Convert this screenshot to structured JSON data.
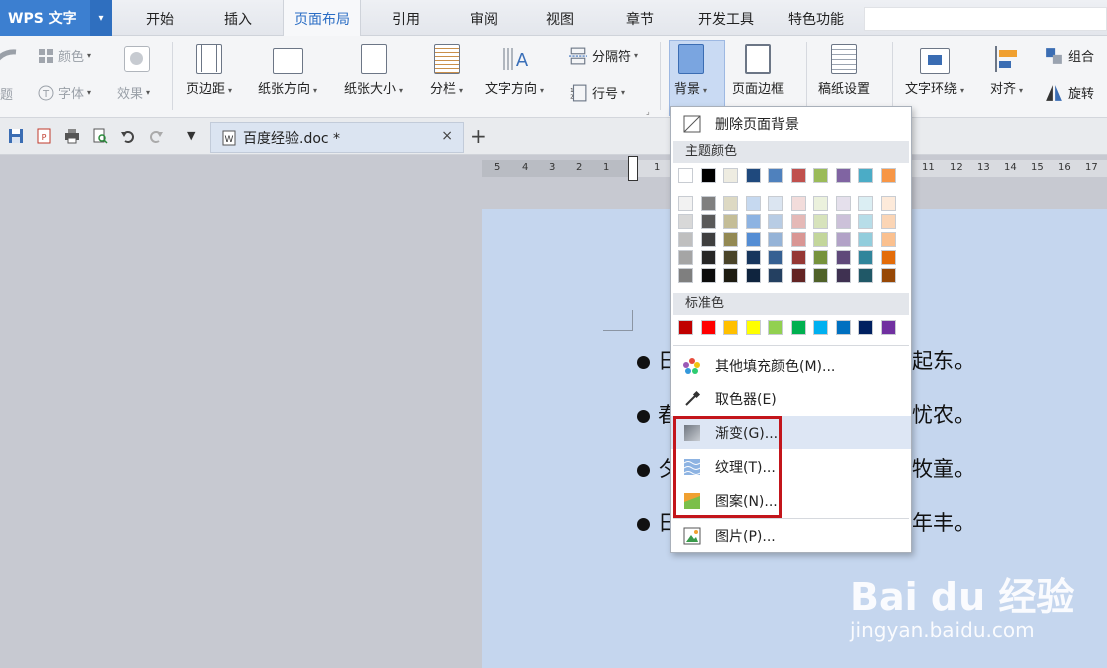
{
  "app": {
    "title": "WPS 文字",
    "arrow": "▾"
  },
  "menu": {
    "tabs": [
      "开始",
      "插入",
      "页面布局",
      "引用",
      "审阅",
      "视图",
      "章节",
      "开发工具",
      "特色功能"
    ],
    "active_index": 2
  },
  "ribbon": {
    "theme_group": {
      "colors": "颜色",
      "fonts": "字体",
      "effects": "效果",
      "theme_partial": "题"
    },
    "page_setup": {
      "margins": "页边距",
      "orientation": "纸张方向",
      "size": "纸张大小",
      "columns": "分栏",
      "text_direction": "文字方向",
      "breaks": "分隔符",
      "line_numbers": "行号"
    },
    "background": {
      "background": "背景",
      "page_border": "页面边框"
    },
    "draft_setup": "稿纸设置",
    "arrange": {
      "wrap_text": "文字环绕",
      "align": "对齐",
      "group": "组合",
      "rotate": "旋转"
    }
  },
  "quickbar": {
    "doc_tab": "百度经验.doc *",
    "close": "×",
    "new_tab": "+"
  },
  "ruler": {
    "ticks": [
      "5",
      "4",
      "3",
      "2",
      "1",
      "1",
      "11",
      "12",
      "13",
      "14",
      "15",
      "16",
      "17"
    ]
  },
  "document": {
    "lines": [
      {
        "start": "日",
        "end": "起东。"
      },
      {
        "start": "春",
        "end": "忧农。"
      },
      {
        "start": "夕",
        "end": "牧童。"
      },
      {
        "start": "日",
        "end": "年丰。"
      }
    ]
  },
  "dropdown": {
    "remove_bg": "删除页面背景",
    "theme_colors_header": "主题颜色",
    "standard_colors_header": "标准色",
    "more_colors": "其他填充颜色(M)...",
    "eyedropper": "取色器(E)",
    "gradient": "渐变(G)...",
    "texture": "纹理(T)...",
    "pattern": "图案(N)...",
    "picture": "图片(P)...",
    "theme_top_row": [
      "#ffffff",
      "#000000",
      "#eeece1",
      "#1f497d",
      "#4f81bd",
      "#c0504d",
      "#9bbb59",
      "#8064a2",
      "#4bacc6",
      "#f79646"
    ],
    "theme_shades": [
      [
        "#f2f2f2",
        "#7f7f7f",
        "#ddd9c3",
        "#c6d9f0",
        "#dbe5f1",
        "#f2dcdb",
        "#ebf1dd",
        "#e5e0ec",
        "#dbeef3",
        "#fdeada"
      ],
      [
        "#d8d8d8",
        "#595959",
        "#c4bd97",
        "#8db3e2",
        "#b8cce4",
        "#e5b9b7",
        "#d7e3bc",
        "#ccc1d9",
        "#b7dde8",
        "#fbd5b5"
      ],
      [
        "#bfbfbf",
        "#3f3f3f",
        "#938953",
        "#548dd4",
        "#95b3d7",
        "#d99694",
        "#c3d69b",
        "#b2a2c7",
        "#92cddc",
        "#fac08f"
      ],
      [
        "#a5a5a5",
        "#262626",
        "#494429",
        "#17365d",
        "#366092",
        "#953734",
        "#76923c",
        "#5f497a",
        "#31859b",
        "#e36c09"
      ],
      [
        "#7f7f7f",
        "#0c0c0c",
        "#1d1b10",
        "#0f243e",
        "#244061",
        "#632423",
        "#4f6128",
        "#3f3151",
        "#205867",
        "#974806"
      ]
    ],
    "standard_colors": [
      "#c00000",
      "#ff0000",
      "#ffc000",
      "#ffff00",
      "#92d050",
      "#00b050",
      "#00b0f0",
      "#0070c0",
      "#002060",
      "#7030a0"
    ]
  },
  "watermark": {
    "logo": "Bai du 经验",
    "url": "jingyan.baidu.com"
  }
}
